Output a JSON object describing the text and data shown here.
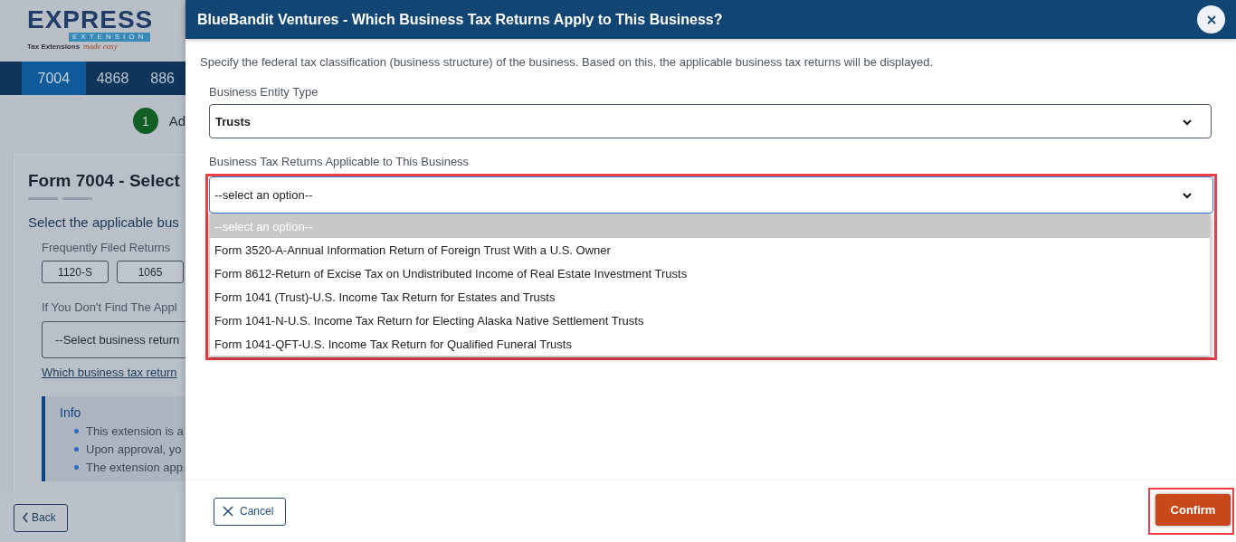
{
  "background_page": {
    "logo": {
      "wordmark": "EXPRESS",
      "band": "EXTENSION",
      "tagline": "Tax Extensions",
      "tagline_script": "made easy"
    },
    "nav_tabs": [
      {
        "label": "7004",
        "selected": true
      },
      {
        "label": "4868",
        "selected": false
      },
      {
        "label": "886",
        "selected": false
      }
    ],
    "step": {
      "number": "1",
      "label": "Ad"
    },
    "card": {
      "title": "Form 7004 - Select",
      "subtitle": "Select the applicable bus",
      "frequent_label": "Frequently Filed Returns",
      "frequent_returns": [
        "1120-S",
        "1065"
      ],
      "other_label": "If You Don't Find The Appl",
      "other_select": {
        "placeholder": "--Select business return"
      },
      "help_link": "Which business tax return",
      "info": {
        "title": "Info",
        "bullets": [
          "This extension is a",
          "Upon approval, yo",
          "The extension app"
        ]
      }
    },
    "back_button": "Back"
  },
  "modal": {
    "title": "BlueBandit Ventures - Which Business Tax Returns Apply to This Business?",
    "description": "Specify the federal tax classification (business structure) of the business. Based on this, the applicable business tax returns will be displayed.",
    "entity_field": {
      "label": "Business Entity Type",
      "value": "Trusts"
    },
    "returns_field": {
      "label": "Business Tax Returns Applicable to This Business",
      "value": "--select an option--",
      "expanded": true,
      "highlighted": true,
      "options": [
        {
          "label": "--select an option--",
          "selected": true
        },
        {
          "label": "Form 3520-A-Annual Information Return of Foreign Trust With a U.S. Owner",
          "selected": false
        },
        {
          "label": "Form 8612-Return of Excise Tax on Undistributed Income of Real Estate Investment Trusts",
          "selected": false
        },
        {
          "label": "Form 1041 (Trust)-U.S. Income Tax Return for Estates and Trusts",
          "selected": false
        },
        {
          "label": "Form 1041-N-U.S. Income Tax Return for Electing Alaska Native Settlement Trusts",
          "selected": false
        },
        {
          "label": "Form 1041-QFT-U.S. Income Tax Return for Qualified Funeral Trusts",
          "selected": false
        }
      ]
    },
    "cancel_button": "Cancel",
    "confirm_button": {
      "label": "Confirm",
      "highlighted": true
    }
  }
}
